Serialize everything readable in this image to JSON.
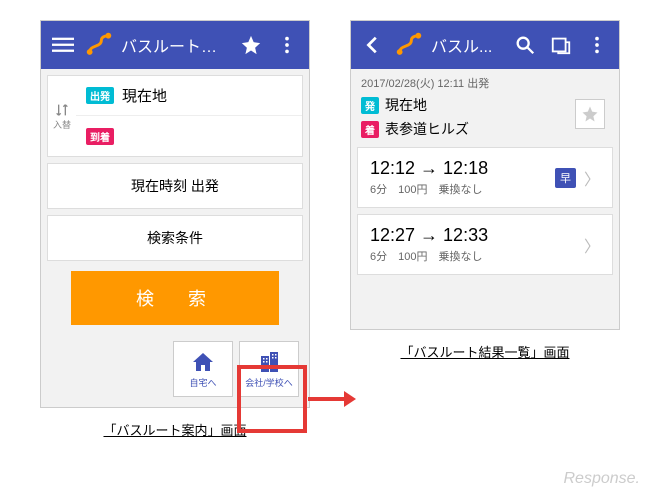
{
  "left": {
    "appbar": {
      "title": "バスルート案内"
    },
    "swap_label": "入替",
    "dep_badge": "出発",
    "arr_badge": "到着",
    "dep_text": "現在地",
    "opt_time": "現在時刻 出発",
    "opt_cond": "検索条件",
    "search_label": "検　索",
    "shortcut_home": "自宅へ",
    "shortcut_work": "会社/学校へ",
    "caption": "「バスルート案内」画面"
  },
  "right": {
    "appbar": {
      "title": "バスル..."
    },
    "meta": "2017/02/28(火) 12:11 出発",
    "dep_badge": "発",
    "arr_badge": "着",
    "dep_text": "現在地",
    "arr_text": "表参道ヒルズ",
    "results": [
      {
        "times": "12:12 → 12:18",
        "sub": "6分　100円　乗換なし",
        "fast": "早"
      },
      {
        "times": "12:27 → 12:33",
        "sub": "6分　100円　乗換なし",
        "fast": ""
      }
    ],
    "caption": "「バスルート結果一覧」画面"
  },
  "watermark": "Response."
}
